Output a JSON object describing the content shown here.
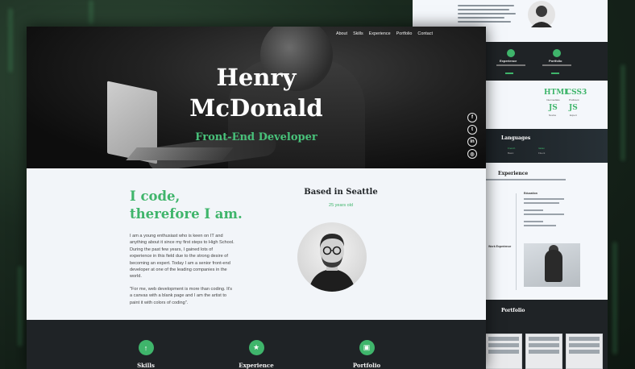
{
  "nav": [
    "About",
    "Skills",
    "Experience",
    "Portfolio",
    "Contact"
  ],
  "hero": {
    "name_line1": "Henry",
    "name_line2": "McDonald",
    "role": "Front-End Developer"
  },
  "social": [
    {
      "icon": "facebook-icon",
      "glyph": "f"
    },
    {
      "icon": "twitter-icon",
      "glyph": "t"
    },
    {
      "icon": "linkedin-icon",
      "glyph": "in"
    },
    {
      "icon": "instagram-icon",
      "glyph": "◎"
    }
  ],
  "about": {
    "motto_line1": "I code,",
    "motto_line2": "therefore I am.",
    "bio_p1": "I am a young enthusiast who is keen on IT and anything about it since my first steps to High School. During the past few years, I gained lots of experience in this field due to the strong desire of becoming an expert. Today I am a senior front-end developer at one of the leading companies in the world.",
    "bio_p2": "\"For me, web development is more than coding. It's a canvas with a blank page and I am the artist to paint it with colors of coding\".",
    "based": "Based in Seattle",
    "age": "25 years old"
  },
  "services": [
    {
      "label": "Skills",
      "icon": "arrow-up-icon",
      "glyph": "↑"
    },
    {
      "label": "Experience",
      "icon": "star-icon",
      "glyph": "★"
    },
    {
      "label": "Portfolio",
      "icon": "briefcase-icon",
      "glyph": "▣"
    }
  ],
  "back_page": {
    "card1": "Experience",
    "card2": "Portfolio",
    "skills": [
      {
        "name": "HTML",
        "sub": "Intermediate"
      },
      {
        "name": "CSS3",
        "sub": "Proficient"
      },
      {
        "name": "JS",
        "sub": "Novice"
      },
      {
        "name": "JS",
        "sub": "Expert"
      }
    ],
    "languages_title": "Languages",
    "languages": [
      {
        "name": "French",
        "level": "Basic"
      },
      {
        "name": "Italian",
        "level": "Fluent"
      }
    ],
    "experience_title": "Experience",
    "education_label": "Education",
    "work_label": "Work Experience",
    "portfolio_title": "Portfolio"
  },
  "colors": {
    "accent": "#3fb56b",
    "dark": "#1f2326",
    "light": "#f2f5f9"
  }
}
